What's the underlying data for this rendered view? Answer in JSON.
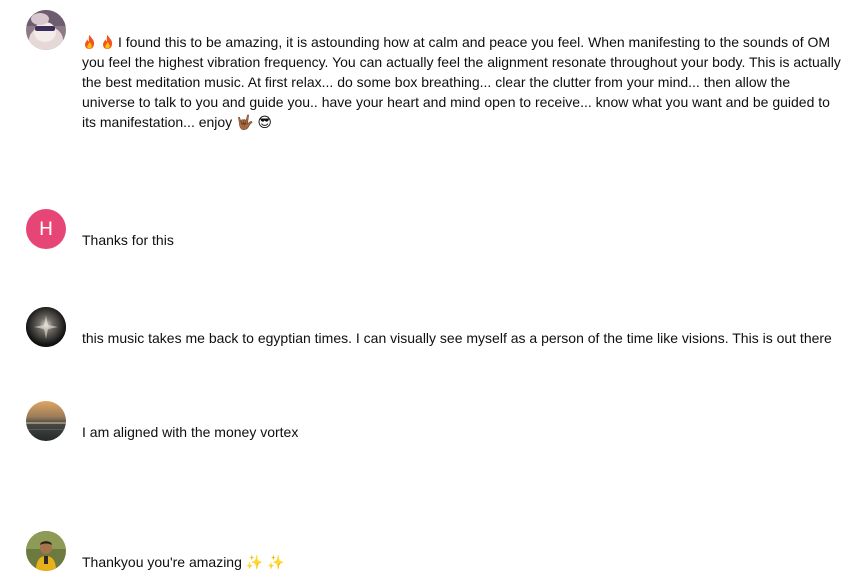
{
  "comments": [
    {
      "avatar": "user-photo-avatar",
      "prefix_emoji": [
        "fire-icon",
        "fire-icon"
      ],
      "text": "I found this to be amazing, it is astounding how at calm and peace you feel. When manifesting to the sounds of OM you feel the highest vibration frequency. You can actually feel the alignment resonate throughout your body. This is actually the best meditation music. At first relax... do some box breathing... clear the clutter from your mind... then allow the universe to talk to you and guide you.. have your heart and mind open to receive... know what you want and be guided to its manifestation... enjoy 🤟🏾 😎"
    },
    {
      "avatar_letter": "H",
      "avatar_color": "#e84577",
      "text": "Thanks for this"
    },
    {
      "avatar": "user-photo-avatar",
      "text": "this music takes me back to egyptian times. I can visually see myself as a person of the time like visions. This is out there"
    },
    {
      "avatar": "sunset-photo-avatar",
      "text": "I am aligned with the money vortex"
    },
    {
      "avatar": "user-photo-avatar",
      "text": "Thankyou you're amazing ✨ ✨"
    }
  ]
}
